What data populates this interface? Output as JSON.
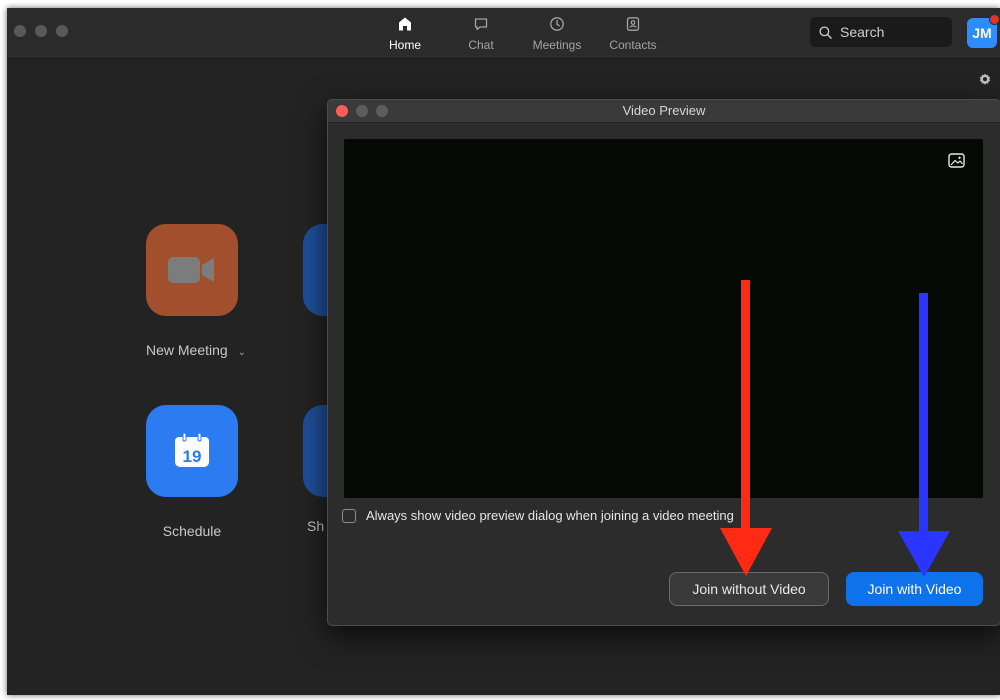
{
  "nav": {
    "items": [
      {
        "label": "Home",
        "icon": "home-icon",
        "active": true
      },
      {
        "label": "Chat",
        "icon": "chat-icon",
        "active": false
      },
      {
        "label": "Meetings",
        "icon": "clock-icon",
        "active": false
      },
      {
        "label": "Contacts",
        "icon": "contacts-icon",
        "active": false
      }
    ]
  },
  "search": {
    "label": "Search"
  },
  "profile": {
    "initials": "JM",
    "color": "#2d8cff",
    "notification_color": "#e0352e"
  },
  "home": {
    "new_meeting": {
      "label": "New Meeting",
      "color": "#a24f2d"
    },
    "schedule": {
      "label": "Schedule",
      "day": "19",
      "color": "#2d7bf0"
    },
    "share_partial": {
      "label": "Sh",
      "color": "#1f4f9a"
    }
  },
  "dialog": {
    "title": "Video Preview",
    "preview_option_label": "Always show video preview dialog when joining a video meeting",
    "join_without_video": "Join without Video",
    "join_with_video": "Join with Video"
  },
  "annotations": {
    "red_arrow_color": "#ff2a14",
    "blue_arrow_color": "#2a35ff"
  }
}
